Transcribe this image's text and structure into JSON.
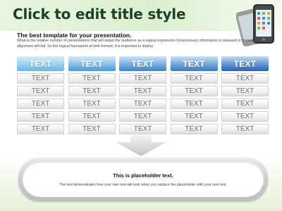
{
  "slide": {
    "title": "Click to edit title style",
    "subheading": "The best template for your presentation.",
    "body_text": "What is the relative number of presentations that will target the audience as a logical expression Unnecessary information is released or increased alignment will fail. So the logical framework of well-formed, it is important to deploy."
  },
  "table": {
    "headers": [
      "TEXT",
      "TEXT",
      "TEXT",
      "TEXT",
      "TEXT"
    ],
    "rows": [
      [
        "TEXT",
        "TEXT",
        "TEXT",
        "TEXT",
        "TEXT"
      ],
      [
        "TEXT",
        "TEXT",
        "TEXT",
        "TEXT",
        "TEXT"
      ],
      [
        "TEXT",
        "TEXT",
        "TEXT",
        "TEXT",
        "TEXT"
      ],
      [
        "TEXT",
        "TEXT",
        "TEXT",
        "TEXT",
        "TEXT"
      ],
      [
        "TEXT",
        "TEXT",
        "TEXT",
        "TEXT",
        "TEXT"
      ]
    ]
  },
  "placeholder": {
    "title": "This is placeholder text.",
    "text": "The text demonstrates how your own text will look when you replace the placeholder with your own text."
  },
  "icons": {
    "decoration": "smartphones-icon",
    "arrow": "arrow-down-icon"
  },
  "colors": {
    "title": "#1c3f28",
    "header_light": "#68b5e3",
    "header_dark": "#2b62b1",
    "cell_text": "#6d6d6d"
  }
}
